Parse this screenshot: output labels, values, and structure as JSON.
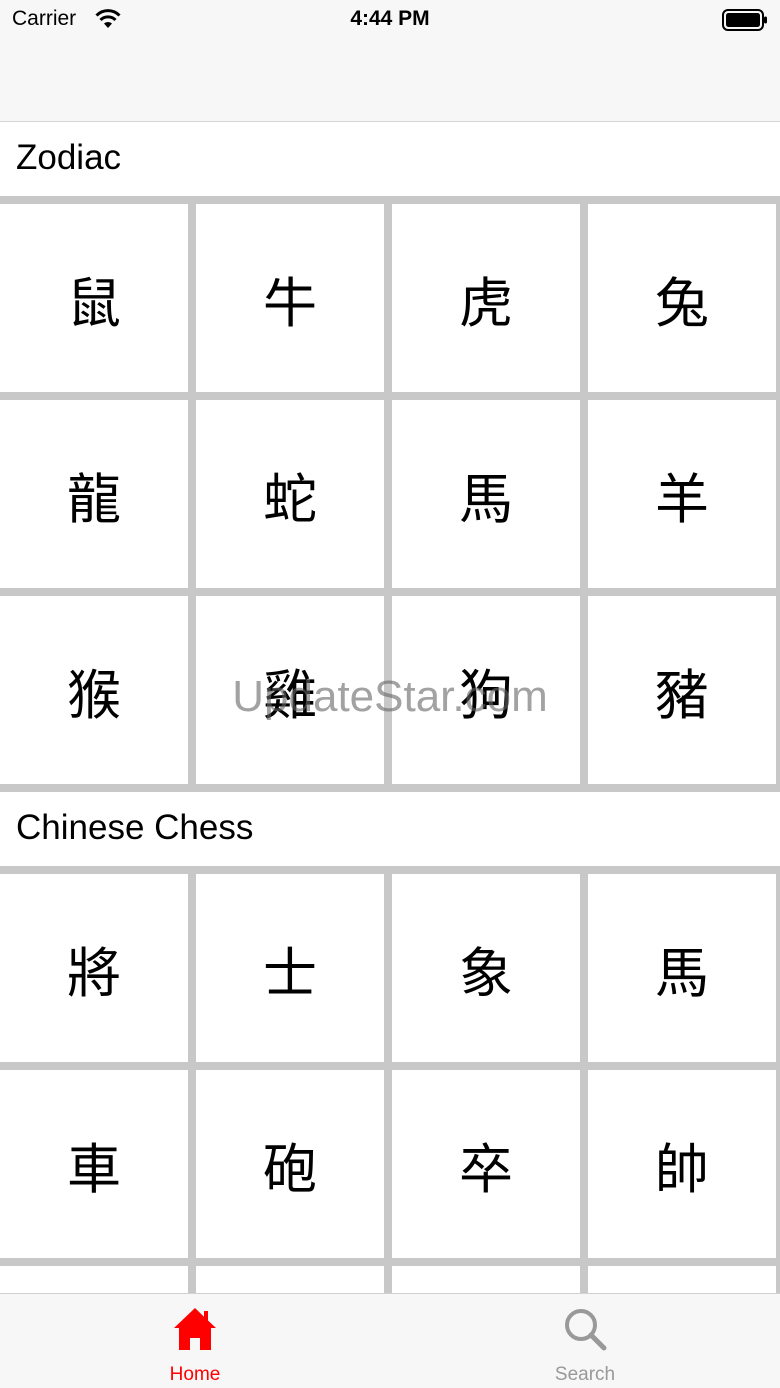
{
  "status_bar": {
    "carrier": "Carrier",
    "time": "4:44 PM"
  },
  "sections": [
    {
      "title": "Zodiac",
      "items": [
        "鼠",
        "牛",
        "虎",
        "兔",
        "龍",
        "蛇",
        "馬",
        "羊",
        "猴",
        "雞",
        "狗",
        "豬"
      ]
    },
    {
      "title": "Chinese Chess",
      "items": [
        "將",
        "士",
        "象",
        "馬",
        "車",
        "砲",
        "卒",
        "帥"
      ]
    }
  ],
  "watermark": "UpdateStar.com",
  "tab_bar": {
    "home_label": "Home",
    "search_label": "Search",
    "active_color": "#ff0000",
    "inactive_color": "#999999"
  }
}
